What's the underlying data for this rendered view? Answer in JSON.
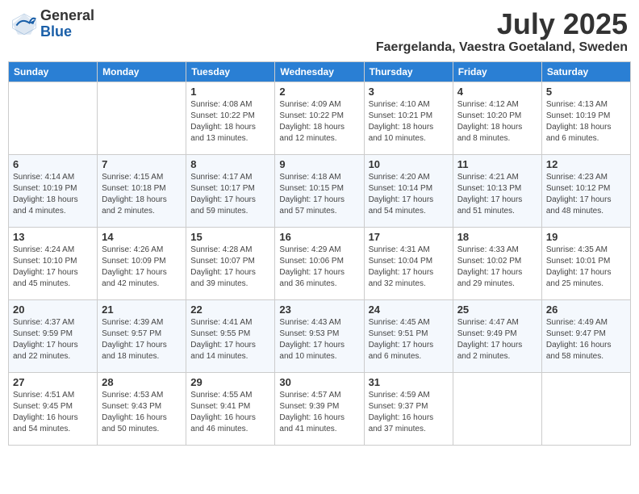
{
  "logo": {
    "general": "General",
    "blue": "Blue"
  },
  "title": {
    "month_year": "July 2025",
    "location": "Faergelanda, Vaestra Goetaland, Sweden"
  },
  "days_of_week": [
    "Sunday",
    "Monday",
    "Tuesday",
    "Wednesday",
    "Thursday",
    "Friday",
    "Saturday"
  ],
  "weeks": [
    [
      {
        "day": "",
        "info": ""
      },
      {
        "day": "",
        "info": ""
      },
      {
        "day": "1",
        "info": "Sunrise: 4:08 AM\nSunset: 10:22 PM\nDaylight: 18 hours\nand 13 minutes."
      },
      {
        "day": "2",
        "info": "Sunrise: 4:09 AM\nSunset: 10:22 PM\nDaylight: 18 hours\nand 12 minutes."
      },
      {
        "day": "3",
        "info": "Sunrise: 4:10 AM\nSunset: 10:21 PM\nDaylight: 18 hours\nand 10 minutes."
      },
      {
        "day": "4",
        "info": "Sunrise: 4:12 AM\nSunset: 10:20 PM\nDaylight: 18 hours\nand 8 minutes."
      },
      {
        "day": "5",
        "info": "Sunrise: 4:13 AM\nSunset: 10:19 PM\nDaylight: 18 hours\nand 6 minutes."
      }
    ],
    [
      {
        "day": "6",
        "info": "Sunrise: 4:14 AM\nSunset: 10:19 PM\nDaylight: 18 hours\nand 4 minutes."
      },
      {
        "day": "7",
        "info": "Sunrise: 4:15 AM\nSunset: 10:18 PM\nDaylight: 18 hours\nand 2 minutes."
      },
      {
        "day": "8",
        "info": "Sunrise: 4:17 AM\nSunset: 10:17 PM\nDaylight: 17 hours\nand 59 minutes."
      },
      {
        "day": "9",
        "info": "Sunrise: 4:18 AM\nSunset: 10:15 PM\nDaylight: 17 hours\nand 57 minutes."
      },
      {
        "day": "10",
        "info": "Sunrise: 4:20 AM\nSunset: 10:14 PM\nDaylight: 17 hours\nand 54 minutes."
      },
      {
        "day": "11",
        "info": "Sunrise: 4:21 AM\nSunset: 10:13 PM\nDaylight: 17 hours\nand 51 minutes."
      },
      {
        "day": "12",
        "info": "Sunrise: 4:23 AM\nSunset: 10:12 PM\nDaylight: 17 hours\nand 48 minutes."
      }
    ],
    [
      {
        "day": "13",
        "info": "Sunrise: 4:24 AM\nSunset: 10:10 PM\nDaylight: 17 hours\nand 45 minutes."
      },
      {
        "day": "14",
        "info": "Sunrise: 4:26 AM\nSunset: 10:09 PM\nDaylight: 17 hours\nand 42 minutes."
      },
      {
        "day": "15",
        "info": "Sunrise: 4:28 AM\nSunset: 10:07 PM\nDaylight: 17 hours\nand 39 minutes."
      },
      {
        "day": "16",
        "info": "Sunrise: 4:29 AM\nSunset: 10:06 PM\nDaylight: 17 hours\nand 36 minutes."
      },
      {
        "day": "17",
        "info": "Sunrise: 4:31 AM\nSunset: 10:04 PM\nDaylight: 17 hours\nand 32 minutes."
      },
      {
        "day": "18",
        "info": "Sunrise: 4:33 AM\nSunset: 10:02 PM\nDaylight: 17 hours\nand 29 minutes."
      },
      {
        "day": "19",
        "info": "Sunrise: 4:35 AM\nSunset: 10:01 PM\nDaylight: 17 hours\nand 25 minutes."
      }
    ],
    [
      {
        "day": "20",
        "info": "Sunrise: 4:37 AM\nSunset: 9:59 PM\nDaylight: 17 hours\nand 22 minutes."
      },
      {
        "day": "21",
        "info": "Sunrise: 4:39 AM\nSunset: 9:57 PM\nDaylight: 17 hours\nand 18 minutes."
      },
      {
        "day": "22",
        "info": "Sunrise: 4:41 AM\nSunset: 9:55 PM\nDaylight: 17 hours\nand 14 minutes."
      },
      {
        "day": "23",
        "info": "Sunrise: 4:43 AM\nSunset: 9:53 PM\nDaylight: 17 hours\nand 10 minutes."
      },
      {
        "day": "24",
        "info": "Sunrise: 4:45 AM\nSunset: 9:51 PM\nDaylight: 17 hours\nand 6 minutes."
      },
      {
        "day": "25",
        "info": "Sunrise: 4:47 AM\nSunset: 9:49 PM\nDaylight: 17 hours\nand 2 minutes."
      },
      {
        "day": "26",
        "info": "Sunrise: 4:49 AM\nSunset: 9:47 PM\nDaylight: 16 hours\nand 58 minutes."
      }
    ],
    [
      {
        "day": "27",
        "info": "Sunrise: 4:51 AM\nSunset: 9:45 PM\nDaylight: 16 hours\nand 54 minutes."
      },
      {
        "day": "28",
        "info": "Sunrise: 4:53 AM\nSunset: 9:43 PM\nDaylight: 16 hours\nand 50 minutes."
      },
      {
        "day": "29",
        "info": "Sunrise: 4:55 AM\nSunset: 9:41 PM\nDaylight: 16 hours\nand 46 minutes."
      },
      {
        "day": "30",
        "info": "Sunrise: 4:57 AM\nSunset: 9:39 PM\nDaylight: 16 hours\nand 41 minutes."
      },
      {
        "day": "31",
        "info": "Sunrise: 4:59 AM\nSunset: 9:37 PM\nDaylight: 16 hours\nand 37 minutes."
      },
      {
        "day": "",
        "info": ""
      },
      {
        "day": "",
        "info": ""
      }
    ]
  ]
}
